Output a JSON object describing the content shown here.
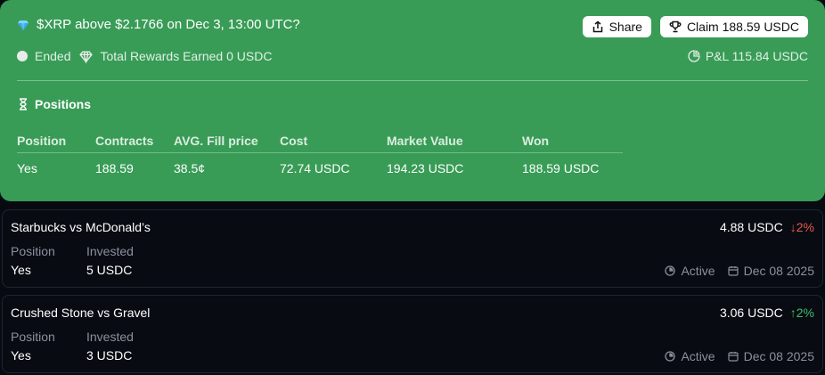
{
  "market": {
    "title": "$XRP above $2.1766 on Dec 3, 13:00 UTC?",
    "share_label": "Share",
    "claim_label": "Claim 188.59 USDC",
    "status": "Ended",
    "rewards": "Total Rewards Earned 0 USDC",
    "pnl": "P&L 115.84 USDC",
    "accent_color": "#389c56"
  },
  "positions": {
    "heading": "Positions",
    "columns": [
      "Position",
      "Contracts",
      "AVG. Fill price",
      "Cost",
      "Market Value",
      "Won"
    ],
    "row": [
      "Yes",
      "188.59",
      "38.5¢",
      "72.74 USDC",
      "194.23 USDC",
      "188.59 USDC"
    ]
  },
  "cards": [
    {
      "title": "Starbucks vs McDonald’s",
      "value": "4.88 USDC",
      "change": "↓2%",
      "change_direction": "down",
      "position_label": "Position",
      "invested_label": "Invested",
      "position": "Yes",
      "invested": "5 USDC",
      "status": "Active",
      "date": "Dec 08 2025"
    },
    {
      "title": "Crushed Stone vs Gravel",
      "value": "3.06 USDC",
      "change": "↑2%",
      "change_direction": "up",
      "position_label": "Position",
      "invested_label": "Invested",
      "position": "Yes",
      "invested": "3 USDC",
      "status": "Active",
      "date": "Dec 08 2025"
    }
  ]
}
